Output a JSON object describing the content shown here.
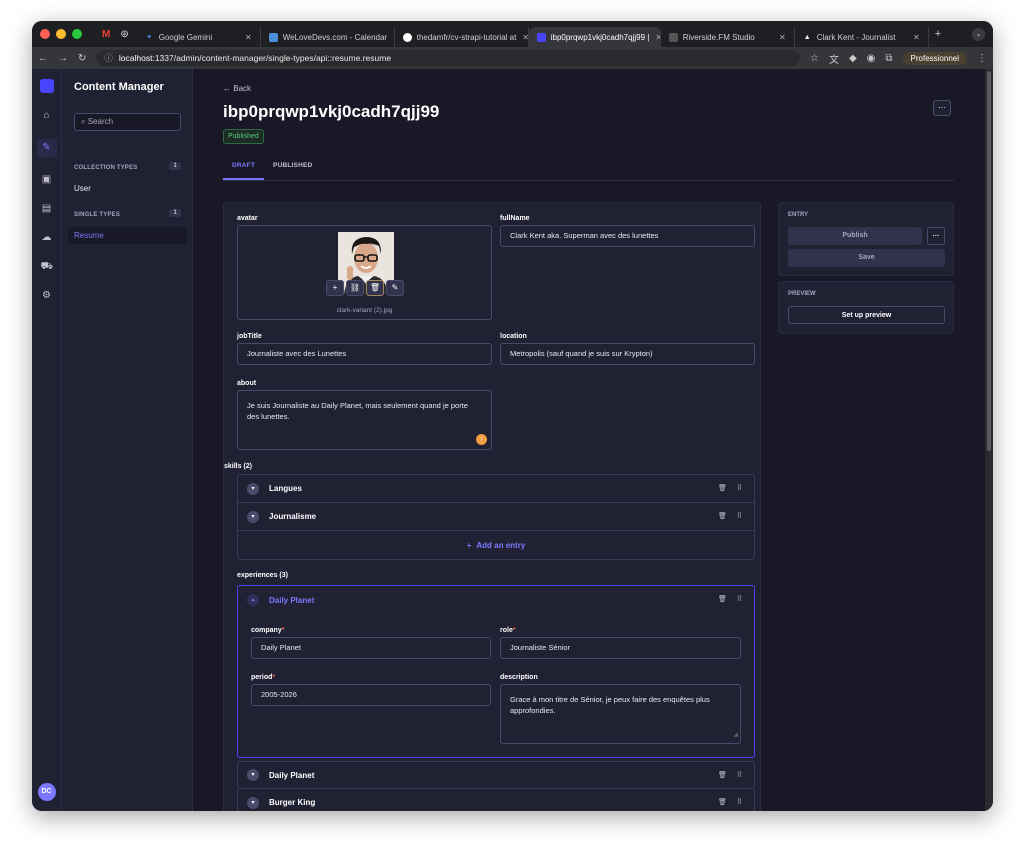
{
  "browser": {
    "tabs": [
      {
        "label": "Google Gemini",
        "color": "#4e8cf7"
      },
      {
        "label": "WeLoveDevs.com - Calendar",
        "color": "#4a90d9"
      },
      {
        "label": "thedamfr/cv-strapi-tutorial at",
        "color": "#ffffff"
      },
      {
        "label": "ibp0prqwp1vkj0cadh7qjj99 |",
        "color": "#4945ff"
      },
      {
        "label": "Riverside.FM Studio",
        "color": "#888888"
      },
      {
        "label": "Clark Kent - Journalist",
        "color": "#ffffff"
      }
    ],
    "url_host": "localhost",
    "url_rest": ":1337/admin/content-manager/single-types/api::resume.resume",
    "profile": "Professionnel"
  },
  "sidebar": {
    "title": "Content Manager",
    "search_placeholder": "Search",
    "collection_label": "COLLECTION TYPES",
    "collection_count": "1",
    "collection_items": [
      "User"
    ],
    "single_label": "SINGLE TYPES",
    "single_count": "1",
    "single_items": [
      "Resume"
    ],
    "user_initials": "DC"
  },
  "header": {
    "back": "Back",
    "title": "ibp0prqwp1vkj0cadh7qjj99",
    "more": "···",
    "status": "Published",
    "tab_draft": "DRAFT",
    "tab_published": "PUBLISHED"
  },
  "form": {
    "avatar_label": "avatar",
    "avatar_filename": "clark-variant (2).jpg",
    "fullname_label": "fullName",
    "fullname_value": "Clark Kent aka. Superman avec des lunettes",
    "jobtitle_label": "jobTitle",
    "jobtitle_value": "Journaliste avec des Lunettes",
    "location_label": "location",
    "location_value": "Metropolis (sauf quand je suis sur Krypton)",
    "about_label": "about",
    "about_value": "Je suis Journaliste au Daily Planet, mais seulement quand je porte des lunettes.",
    "skills_label": "skills (2)",
    "skills": [
      "Langues",
      "Journalisme"
    ],
    "add_entry": "Add an entry",
    "experiences_label": "experiences (3)",
    "experience_open": {
      "title": "Daily Planet",
      "company_label": "company",
      "company_value": "Daily Planet",
      "role_label": "role",
      "role_value": "Journaliste Sénior",
      "period_label": "period",
      "period_value": "2005-2026",
      "description_label": "description",
      "description_value": "Grace à mon titre de Sénior, je peux faire des enquêtes plus approfondies."
    },
    "experiences_closed": [
      "Daily Planet",
      "Burger King"
    ]
  },
  "panel": {
    "entry_label": "ENTRY",
    "publish": "Publish",
    "more": "···",
    "save": "Save",
    "preview_label": "PREVIEW",
    "setup_preview": "Set up preview"
  }
}
